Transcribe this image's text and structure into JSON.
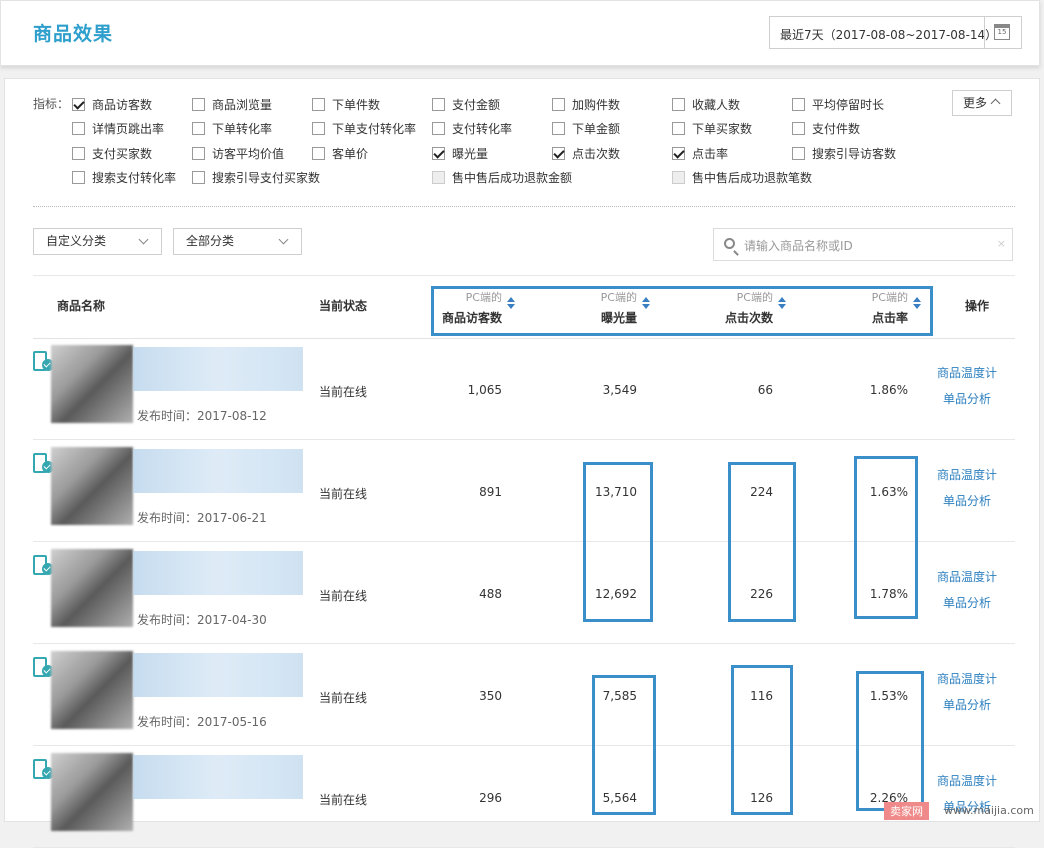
{
  "header": {
    "title": "商品效果",
    "date_range": "最近7天（2017-08-08~2017-08-14）",
    "calendar_day": "15"
  },
  "metrics": {
    "label": "指标：",
    "more_label": "更多",
    "items": [
      {
        "label": "商品访客数",
        "checked": true
      },
      {
        "label": "商品浏览量",
        "checked": false
      },
      {
        "label": "下单件数",
        "checked": false
      },
      {
        "label": "支付金额",
        "checked": false
      },
      {
        "label": "加购件数",
        "checked": false
      },
      {
        "label": "收藏人数",
        "checked": false
      },
      {
        "label": "平均停留时长",
        "checked": false
      },
      {
        "label": "详情页跳出率",
        "checked": false
      },
      {
        "label": "下单转化率",
        "checked": false
      },
      {
        "label": "下单支付转化率",
        "checked": false
      },
      {
        "label": "支付转化率",
        "checked": false
      },
      {
        "label": "下单金额",
        "checked": false
      },
      {
        "label": "下单买家数",
        "checked": false
      },
      {
        "label": "支付件数",
        "checked": false
      },
      {
        "label": "支付买家数",
        "checked": false
      },
      {
        "label": "访客平均价值",
        "checked": false
      },
      {
        "label": "客单价",
        "checked": false
      },
      {
        "label": "曝光量",
        "checked": true
      },
      {
        "label": "点击次数",
        "checked": true
      },
      {
        "label": "点击率",
        "checked": true
      },
      {
        "label": "搜索引导访客数",
        "checked": false
      },
      {
        "label": "搜索支付转化率",
        "checked": false
      },
      {
        "label": "搜索引导支付买家数",
        "checked": false
      },
      {
        "label": "售中售后成功退款金额",
        "checked": false,
        "disabled": true
      },
      {
        "label": "售中售后成功退款笔数",
        "checked": false,
        "disabled": true
      }
    ]
  },
  "filters": {
    "custom_category": "自定义分类",
    "all_category": "全部分类",
    "search_placeholder": "请输入商品名称或ID",
    "clear": "×"
  },
  "table": {
    "columns": {
      "name": "商品名称",
      "status": "当前状态",
      "visitors_sub": "PC端的",
      "visitors": "商品访客数",
      "exposure_sub": "PC端的",
      "exposure": "曝光量",
      "clicks_sub": "PC端的",
      "clicks": "点击次数",
      "ctr_sub": "PC端的",
      "ctr": "点击率",
      "action": "操作"
    },
    "rows": [
      {
        "publish_time": "发布时间：2017-08-12",
        "status": "当前在线",
        "visitors": "1,065",
        "exposure": "3,549",
        "clicks": "66",
        "ctr": "1.86%",
        "op1": "商品温度计",
        "op2": "单品分析"
      },
      {
        "publish_time": "发布时间：2017-06-21",
        "status": "当前在线",
        "visitors": "891",
        "exposure": "13,710",
        "clicks": "224",
        "ctr": "1.63%",
        "op1": "商品温度计",
        "op2": "单品分析"
      },
      {
        "publish_time": "发布时间：2017-04-30",
        "status": "当前在线",
        "visitors": "488",
        "exposure": "12,692",
        "clicks": "226",
        "ctr": "1.78%",
        "op1": "商品温度计",
        "op2": "单品分析"
      },
      {
        "publish_time": "发布时间：2017-05-16",
        "status": "当前在线",
        "visitors": "350",
        "exposure": "7,585",
        "clicks": "116",
        "ctr": "1.53%",
        "op1": "商品温度计",
        "op2": "单品分析"
      },
      {
        "publish_time": "",
        "status": "当前在线",
        "visitors": "296",
        "exposure": "5,564",
        "clicks": "126",
        "ctr": "2.26%",
        "op1": "商品温度计",
        "op2": "单品分析"
      }
    ]
  },
  "watermark": {
    "badge": "卖家网",
    "url": "www.maijia.com"
  },
  "colors": {
    "title": "#2e9fcc",
    "link": "#2c7fbf",
    "highlight": "#3a8fcb",
    "device": "#35a7b0"
  }
}
